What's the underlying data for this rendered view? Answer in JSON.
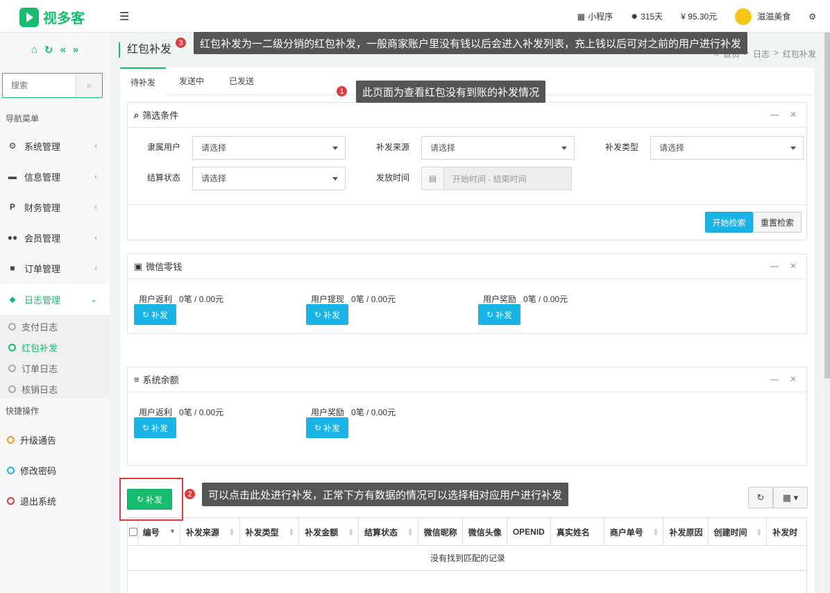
{
  "app": {
    "name": "视多客"
  },
  "topbar": {
    "miniprogram": "小程序",
    "days": "315天",
    "balance": "¥ 95.30元",
    "username": "滋滋美食"
  },
  "sidebar": {
    "search_placeholder": "搜索",
    "nav_header": "导航菜单",
    "items": [
      {
        "label": "系统管理",
        "icon": "gear-icon"
      },
      {
        "label": "信息管理",
        "icon": "briefcase-icon"
      },
      {
        "label": "财务管理",
        "icon": "paypal-icon"
      },
      {
        "label": "会员管理",
        "icon": "users-icon"
      },
      {
        "label": "订单管理",
        "icon": "truck-icon"
      },
      {
        "label": "日志管理",
        "icon": "shield-icon"
      }
    ],
    "sub_items": [
      "支付日志",
      "红包补发",
      "订单日志",
      "核销日志"
    ],
    "quick_header": "快捷操作",
    "quick_items": [
      "升级通告",
      "修改密码",
      "退出系统"
    ]
  },
  "page": {
    "title": "红包补发",
    "breadcrumb": [
      "首页",
      "日志",
      "红包补发"
    ]
  },
  "tabs": [
    "待补发",
    "发送中",
    "已发送"
  ],
  "filter": {
    "title": "筛选条件",
    "owner_label": "隶属用户",
    "source_label": "补发来源",
    "type_label": "补发类型",
    "settle_label": "结算状态",
    "time_label": "发放时间",
    "select_placeholder": "请选择",
    "date_placeholder": "开始时间 - 结束时间",
    "search_btn": "开始检索",
    "reset_btn": "重置检索"
  },
  "wechat_panel": {
    "title": "微信零钱",
    "stats": [
      {
        "label": "用户返利",
        "value": "0笔 / 0.00元"
      },
      {
        "label": "用户提现",
        "value": "0笔 / 0.00元"
      },
      {
        "label": "用户奖励",
        "value": "0笔 / 0.00元"
      }
    ]
  },
  "system_panel": {
    "title": "系统余额",
    "stats": [
      {
        "label": "用户返利",
        "value": "0笔 / 0.00元"
      },
      {
        "label": "用户奖励",
        "value": "0笔 / 0.00元"
      }
    ]
  },
  "patch_label": "补发",
  "table": {
    "columns": [
      "编号",
      "补发来源",
      "补发类型",
      "补发金额",
      "结算状态",
      "微信昵称",
      "微信头像",
      "OPENID",
      "真实姓名",
      "商户单号",
      "补发原因",
      "创建时间",
      "补发时"
    ],
    "empty_text": "没有找到匹配的记录"
  },
  "annotations": [
    {
      "num": "1",
      "text": "此页面为查看红包没有到账的补发情况"
    },
    {
      "num": "2",
      "text": "可以点击此处进行补发，正常下方有数据的情况可以选择相对应用户进行补发"
    },
    {
      "num": "3",
      "text": "红包补发为一二级分销的红包补发，一般商家账户里没有钱以后会进入补发列表，充上钱以后可对之前的用户进行补发"
    }
  ],
  "colors": {
    "brand": "#18bc6e",
    "info": "#1ab3e6",
    "annotation_red": "#e23a3a"
  }
}
